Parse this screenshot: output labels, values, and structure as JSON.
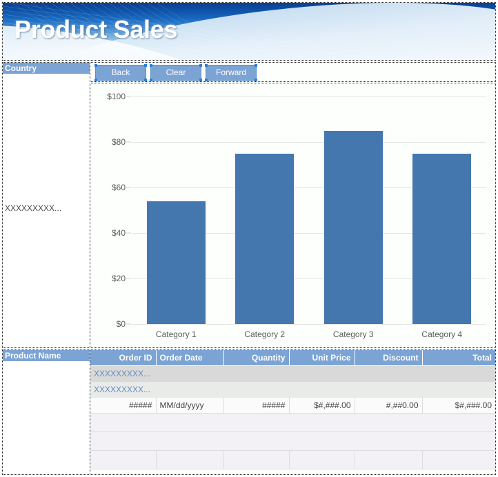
{
  "banner": {
    "title": "Product Sales"
  },
  "toolbar": {
    "back_label": "Back",
    "clear_label": "Clear",
    "forward_label": "Forward"
  },
  "country_group": {
    "header": "Country",
    "value": "XXXXXXXXX..."
  },
  "product_group": {
    "header": "Product Name",
    "value": ""
  },
  "table": {
    "columns": [
      {
        "label": "Order ID",
        "align": "right"
      },
      {
        "label": "Order Date",
        "align": "left"
      },
      {
        "label": "Quantity",
        "align": "right"
      },
      {
        "label": "Unit Price",
        "align": "right"
      },
      {
        "label": "Discount",
        "align": "right"
      },
      {
        "label": "Total",
        "align": "right"
      }
    ],
    "group_rows": [
      "XXXXXXXXX...",
      "XXXXXXXXX..."
    ],
    "detail_row": {
      "order_id": "#####",
      "order_date": "MM/dd/yyyy",
      "quantity": "#####",
      "unit_price": "$#,###.00",
      "discount": "#,##0.00",
      "total": "$#,###.00"
    }
  },
  "chart_data": {
    "type": "bar",
    "title": "",
    "xlabel": "",
    "ylabel": "",
    "categories": [
      "Category 1",
      "Category 2",
      "Category 3",
      "Category 4"
    ],
    "values": [
      54,
      75,
      85,
      75
    ],
    "ylim": [
      0,
      100
    ],
    "yticks": [
      0,
      20,
      40,
      60,
      80,
      100
    ],
    "ytick_labels": [
      "$0",
      "$20",
      "$40",
      "$60",
      "$80",
      "$100"
    ],
    "grid": true,
    "legend": "none",
    "bar_color": "#4477ae",
    "plot_background": "#fdfffc"
  },
  "colors": {
    "accent_blue": "#7ba3d4",
    "bar_blue": "#4477ae",
    "banner_dark": "#0b3f8f",
    "group_row_a": "#d9d9d9",
    "group_row_b": "#e9ebe9",
    "footer_row": "#f4f1f6"
  }
}
